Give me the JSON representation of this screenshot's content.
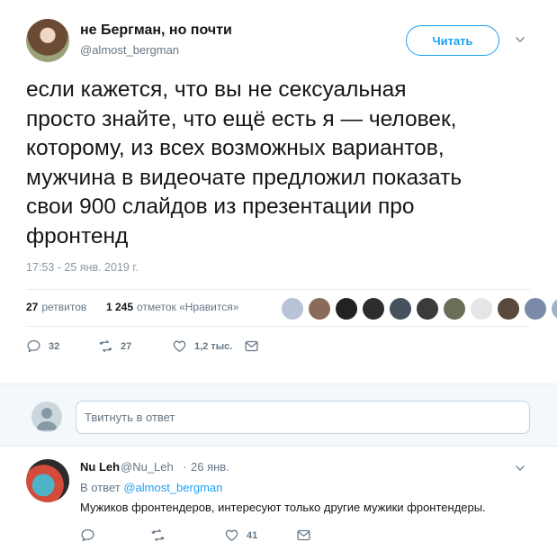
{
  "tweet": {
    "author_name": "не Бергман, но почти",
    "author_handle": "@almost_bergman",
    "follow_label": "Читать",
    "text": "если кажется, что вы не сексуальная\nпросто знайте, что ещё есть я — человек,\nкоторому, из всех возможных вариантов,\nмужчина в видеочате предложил показать\nсвои 900 слайдов из презентации про\nфронтенд",
    "timestamp": "17:53 - 25 янв. 2019 г.",
    "retweets_count": "27",
    "retweets_label": "ретвитов",
    "likes_count": "1 245",
    "likes_label": "отметок «Нравится»",
    "liker_colors": [
      "#b8c4d6",
      "#8a6a5a",
      "#222222",
      "#2d2d2d",
      "#46515e",
      "#3b3b3b",
      "#6a6f58",
      "#e5e5e5",
      "#5a4a3e",
      "#7b8aa8",
      "#9fb2c7"
    ],
    "actions": {
      "replies": "32",
      "retweets": "27",
      "likes": "1,2 тыс."
    }
  },
  "reply_box": {
    "placeholder": "Твитнуть в ответ"
  },
  "reply": {
    "name": "Nu Leh",
    "handle": "@Nu_Leh",
    "separator": "·",
    "date": "26 янв.",
    "replying_prefix": "В ответ",
    "replying_to": "@almost_bergman",
    "text": "Мужиков фронтендеров, интересуют только другие мужики фронтендеры.",
    "actions": {
      "likes": "41"
    }
  },
  "colors": {
    "accent": "#1da1f2",
    "muted": "#657786",
    "text": "#14171a",
    "divider": "#e6ecf0"
  }
}
